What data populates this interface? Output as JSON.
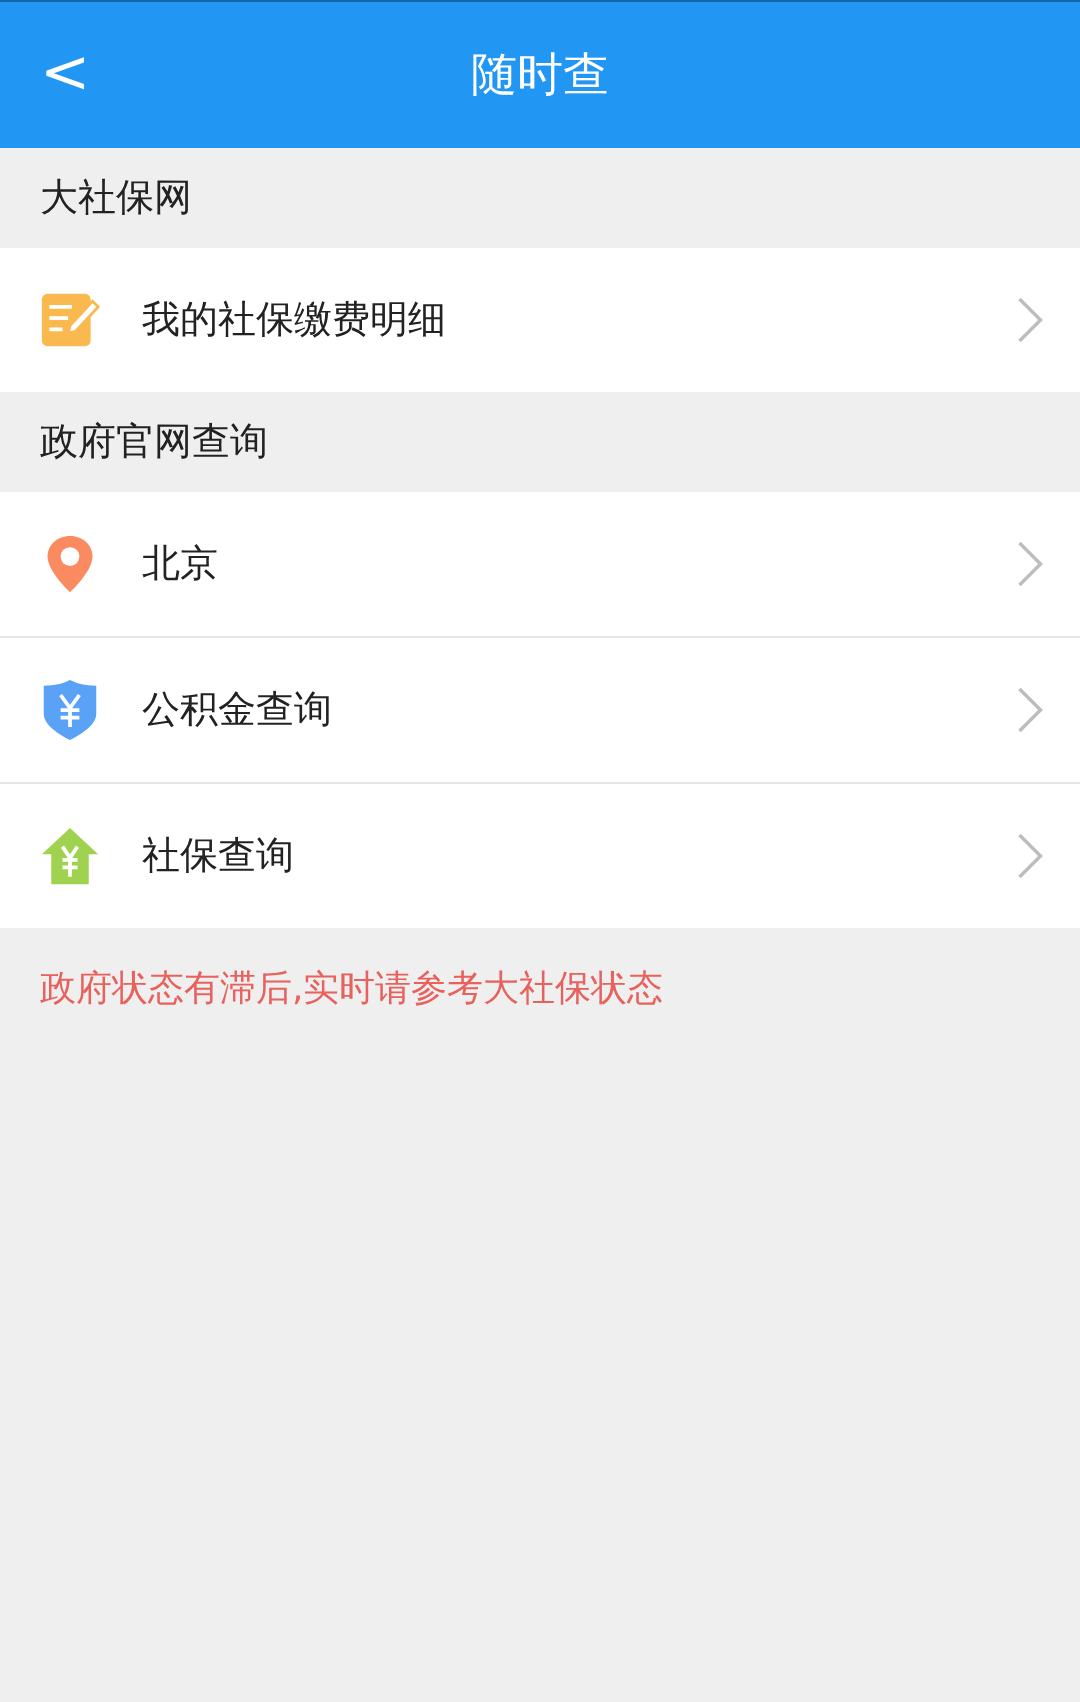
{
  "header": {
    "back": "<",
    "title": "随时查"
  },
  "sections": [
    {
      "title": "大社保网",
      "items": [
        {
          "kind": "note",
          "label": "我的社保缴费明细"
        }
      ]
    },
    {
      "title": "政府官网查询",
      "items": [
        {
          "kind": "pin",
          "label": "北京"
        },
        {
          "kind": "shield",
          "label": "公积金查询"
        },
        {
          "kind": "house",
          "label": "社保查询"
        }
      ]
    }
  ],
  "notice": "政府状态有滞后,实时请参考大社保状态"
}
